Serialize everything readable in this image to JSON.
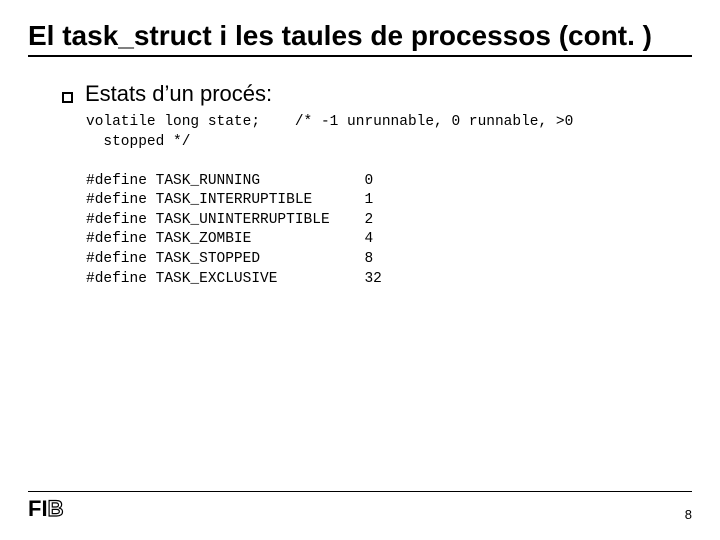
{
  "title": "El task_struct i les taules de processos (cont. )",
  "bullet": "Estats d’un procés:",
  "code": "volatile long state;    /* -1 unrunnable, 0 runnable, >0\n  stopped */\n\n#define TASK_RUNNING            0\n#define TASK_INTERRUPTIBLE      1\n#define TASK_UNINTERRUPTIBLE    2\n#define TASK_ZOMBIE             4\n#define TASK_STOPPED            8\n#define TASK_EXCLUSIVE          32",
  "logo_solid": "FI",
  "logo_outline": "B",
  "page_number": "8"
}
